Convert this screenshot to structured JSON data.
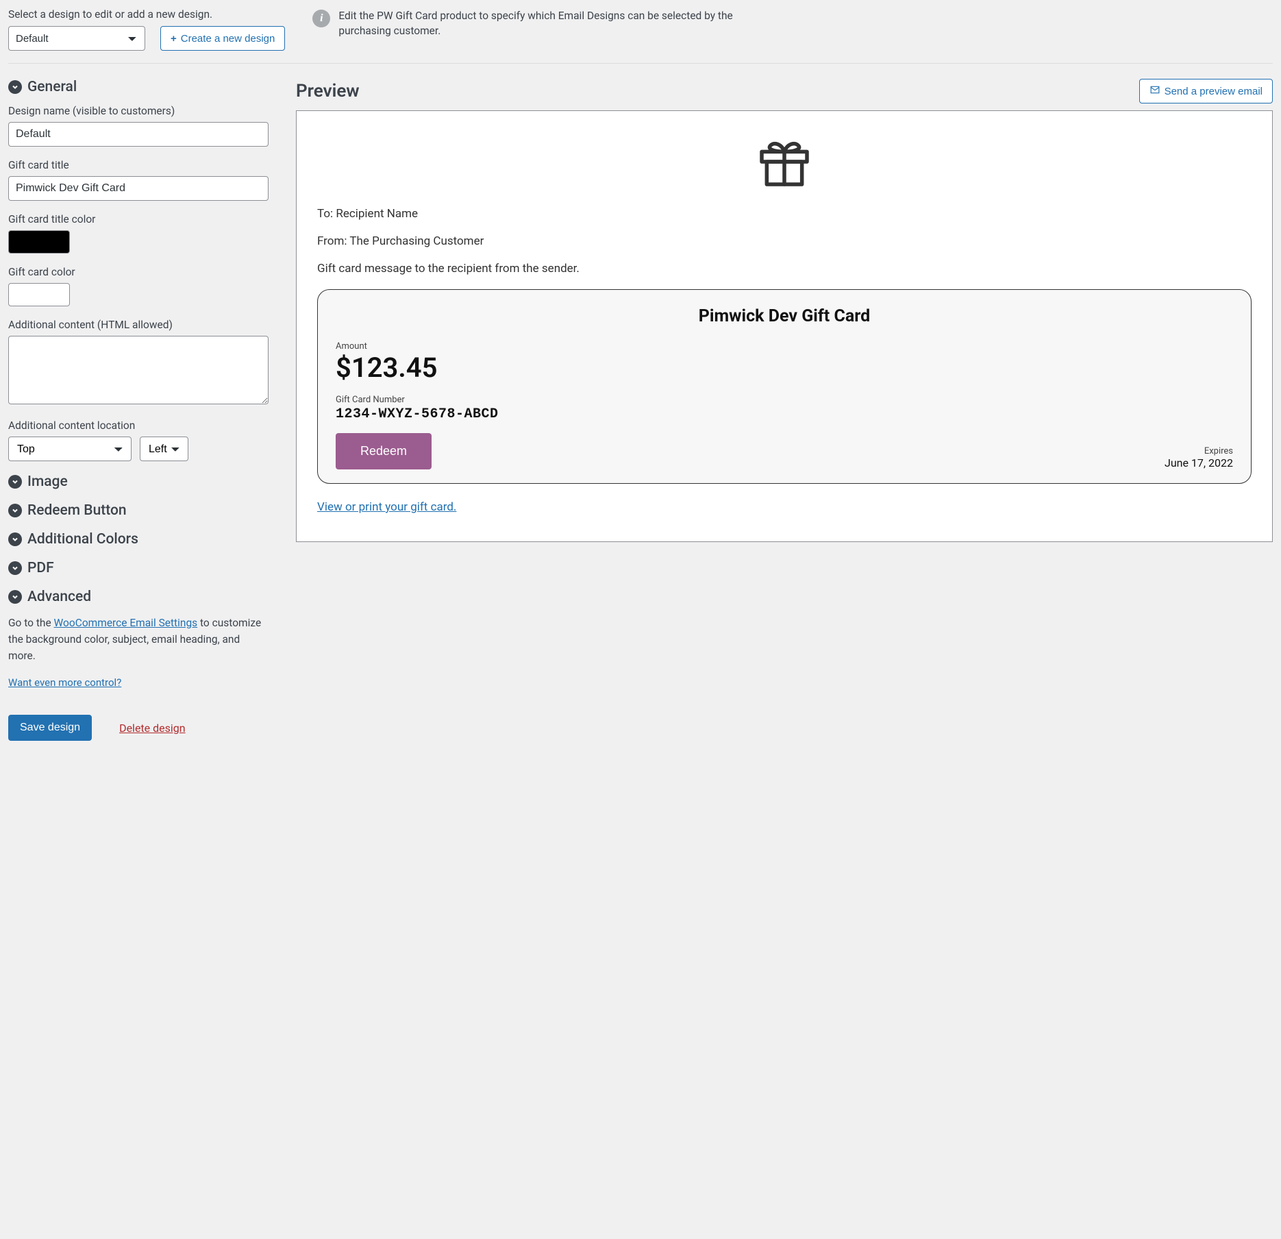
{
  "top": {
    "select_label": "Select a design to edit or add a new design.",
    "selected_design": "Default",
    "create_button": "Create a new design",
    "info_text": "Edit the PW Gift Card product to specify which Email Designs can be selected by the purchasing customer."
  },
  "sections": {
    "general": "General",
    "image": "Image",
    "redeem_button": "Redeem Button",
    "additional_colors": "Additional Colors",
    "pdf": "PDF",
    "advanced": "Advanced"
  },
  "fields": {
    "design_name_label": "Design name (visible to customers)",
    "design_name_value": "Default",
    "gift_card_title_label": "Gift card title",
    "gift_card_title_value": "Pimwick Dev Gift Card",
    "title_color_label": "Gift card title color",
    "title_color_value": "#000000",
    "card_color_label": "Gift card color",
    "card_color_value": "#ffffff",
    "additional_content_label": "Additional content (HTML allowed)",
    "additional_content_value": "",
    "additional_location_label": "Additional content location",
    "location_vertical": "Top",
    "location_horizontal": "Left"
  },
  "helper": {
    "prefix": "Go to the ",
    "link": "WooCommerce Email Settings",
    "suffix": " to customize the background color, subject, email heading, and more.",
    "more_control": "Want even more control?"
  },
  "actions": {
    "save": "Save design",
    "delete": "Delete design"
  },
  "preview": {
    "title": "Preview",
    "send_email": "Send a preview email",
    "to": "To: Recipient Name",
    "from": "From: The Purchasing Customer",
    "message": "Gift card message to the recipient from the sender.",
    "card_title": "Pimwick Dev Gift Card",
    "amount_label": "Amount",
    "amount": "$123.45",
    "number_label": "Gift Card Number",
    "number": "1234-WXYZ-5678-ABCD",
    "redeem": "Redeem",
    "expires_label": "Expires",
    "expires_date": "June 17, 2022",
    "view_print": "View or print your gift card."
  }
}
